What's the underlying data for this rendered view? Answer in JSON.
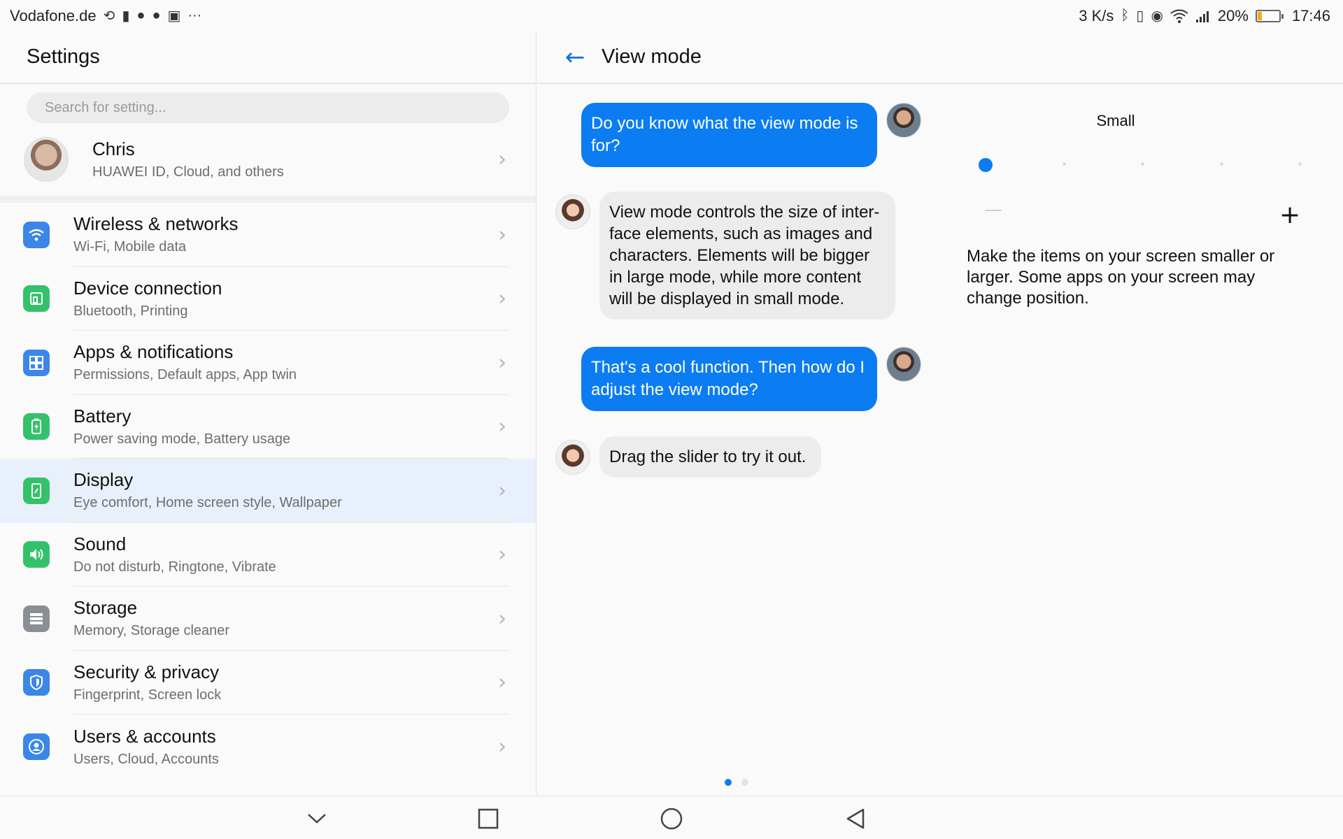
{
  "status_bar": {
    "carrier": "Vodafone.de",
    "left_icons": [
      "rotate-lock-icon",
      "sim-icon",
      "notification-icon",
      "notification-icon",
      "image-icon"
    ],
    "more": "···",
    "speed": "3 K/s",
    "battery_percent": "20%",
    "battery_level": 0.2,
    "time": "17:46"
  },
  "settings": {
    "title": "Settings",
    "search_placeholder": "Search for setting...",
    "account": {
      "name": "Chris",
      "subtitle": "HUAWEI ID, Cloud, and others"
    },
    "items": [
      {
        "title": "Wireless & networks",
        "subtitle": "Wi-Fi, Mobile data",
        "icon": "wifi-icon",
        "color": "#3b86e8"
      },
      {
        "title": "Device connection",
        "subtitle": "Bluetooth, Printing",
        "icon": "device-connection-icon",
        "color": "#33c26a"
      },
      {
        "title": "Apps & notifications",
        "subtitle": "Permissions, Default apps, App twin",
        "icon": "apps-icon",
        "color": "#3b86e8"
      },
      {
        "title": "Battery",
        "subtitle": "Power saving mode, Battery usage",
        "icon": "battery-icon",
        "color": "#33c26a"
      },
      {
        "title": "Display",
        "subtitle": "Eye comfort, Home screen style, Wallpaper",
        "icon": "display-icon",
        "color": "#33c26a",
        "active": true
      },
      {
        "title": "Sound",
        "subtitle": "Do not disturb, Ringtone, Vibrate",
        "icon": "sound-icon",
        "color": "#33c26a"
      },
      {
        "title": "Storage",
        "subtitle": "Memory, Storage cleaner",
        "icon": "storage-icon",
        "color": "#8a8f96"
      },
      {
        "title": "Security & privacy",
        "subtitle": "Fingerprint, Screen lock",
        "icon": "shield-icon",
        "color": "#3b86e8"
      },
      {
        "title": "Users & accounts",
        "subtitle": "Users, Cloud, Accounts",
        "icon": "user-icon",
        "color": "#3b86e8"
      }
    ]
  },
  "view_mode": {
    "title": "View mode",
    "messages": [
      {
        "from": "user",
        "text": "Do you know what the view mode is for?"
      },
      {
        "from": "assistant",
        "text": "View mode controls the size of inter-face elements, such as images and characters. Elements will be bigger in large mode, while more content will be displayed in small mode."
      },
      {
        "from": "user",
        "text": "That's a cool function. Then how do I adjust the view mode?"
      },
      {
        "from": "assistant",
        "text": "Drag the slider to try it out."
      }
    ],
    "size_label": "Small",
    "slider_steps": 5,
    "slider_value_index": 0,
    "minus_label": "−",
    "plus_label": "+",
    "description": "Make the items on your screen smaller or larger. Some apps on your screen may change position.",
    "pages": 2,
    "current_page": 1
  },
  "colors": {
    "accent": "#0b7cf2",
    "selected_row": "#e8f0fb"
  }
}
